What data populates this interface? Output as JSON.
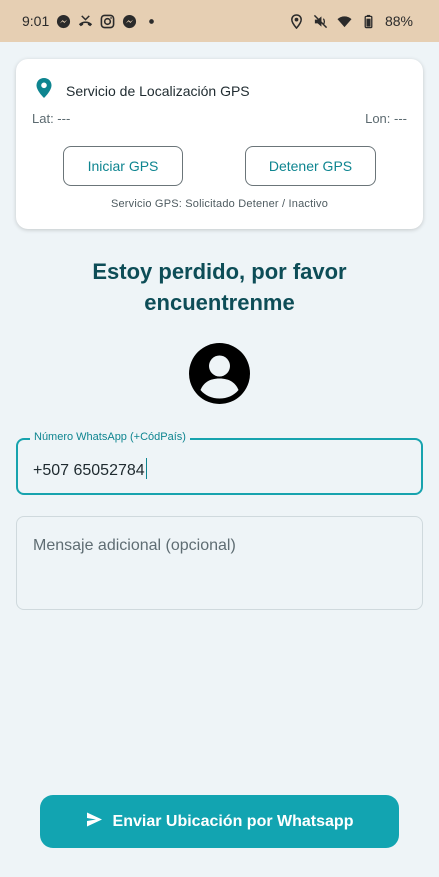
{
  "status_bar": {
    "time": "9:01",
    "battery": "88%",
    "icons_left": [
      "messenger-icon",
      "missed-call-icon",
      "instagram-icon",
      "messenger-icon",
      "dot-icon"
    ],
    "icons_right": [
      "location-icon",
      "mute-icon",
      "wifi-icon",
      "battery-icon"
    ]
  },
  "gps_card": {
    "title": "Servicio de Localización GPS",
    "lat": "Lat: ---",
    "lon": "Lon: ---",
    "start_label": "Iniciar GPS",
    "stop_label": "Detener GPS",
    "status": "Servicio GPS: Solicitado Detener / Inactivo"
  },
  "headline": "Estoy perdido, por favor encuentrenme",
  "whatsapp_field": {
    "label": "Número WhatsApp (+CódPaís)",
    "value": "+507 65052784"
  },
  "message_field": {
    "placeholder": "Mensaje adicional (opcional)"
  },
  "send_button": {
    "label": "Enviar Ubicación por Whatsapp"
  },
  "colors": {
    "accent": "#12a4b1",
    "headline": "#0d4d57",
    "status_bar": "#e6cfb3",
    "background": "#eef4f7"
  }
}
